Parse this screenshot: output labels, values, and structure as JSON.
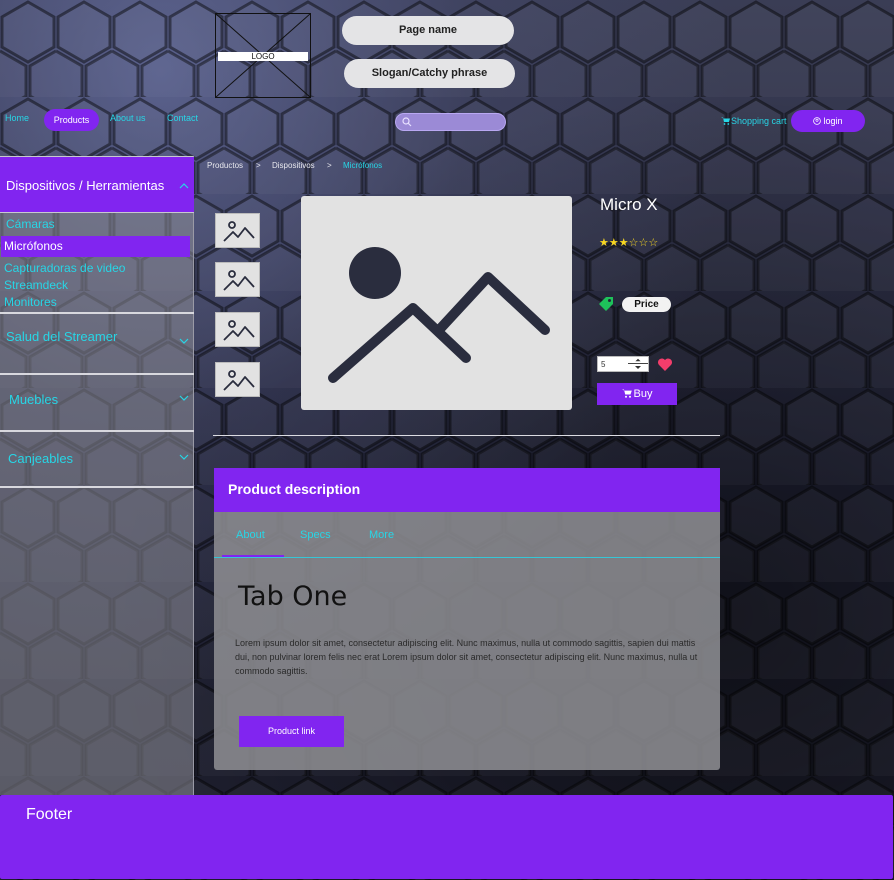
{
  "header": {
    "logo_label": "LOGO",
    "page_name": "Page name",
    "slogan": "Slogan/Catchy phrase"
  },
  "nav": {
    "home": "Home",
    "products": "Products",
    "about": "About us",
    "contact": "Contact"
  },
  "search": {
    "value": "",
    "placeholder": ""
  },
  "cart_label": "Shopping cart",
  "login_label": "login",
  "sidebar": {
    "active_category": "Dispositivos / Herramientas",
    "sub_items": [
      "Cámaras",
      "Micrófonos",
      "Capturadoras de video",
      "Streamdeck",
      "Monitores"
    ],
    "selected_sub_item": "Micrófonos",
    "categories": [
      "Salud del Streamer",
      "Muebles",
      "Canjeables"
    ]
  },
  "breadcrumb": {
    "items": [
      "Productos",
      "Dispositivos",
      "Micrófonos"
    ],
    "separator": ">"
  },
  "product": {
    "title": "Micro X",
    "rating": 3,
    "rating_max": 6,
    "price_label": "Price",
    "quantity": "5",
    "buy_label": "Buy"
  },
  "description": {
    "title": "Product description",
    "tabs": [
      "About",
      "Specs",
      "More"
    ],
    "active_tab": "About",
    "tab_heading": "Tab One",
    "text": "Lorem ipsum dolor sit amet, consectetur adipiscing elit. Nunc maximus, nulla ut commodo sagittis, sapien dui mattis dui, non pulvinar lorem felis nec erat Lorem ipsum dolor sit amet, consectetur adipiscing elit. Nunc maximus, nulla ut commodo sagittis.",
    "link_label": "Product link"
  },
  "footer": {
    "title": "Footer"
  },
  "colors": {
    "accent": "#8125f0",
    "link": "#27d6e6",
    "star": "#f7d722",
    "heart": "#f23d6b",
    "tag": "#1ec25a"
  },
  "icons": [
    "search-icon",
    "cart-icon",
    "user-icon",
    "chevron-up-icon",
    "chevron-down-icon",
    "tag-icon",
    "heart-icon",
    "image-placeholder-icon",
    "star-icon"
  ]
}
